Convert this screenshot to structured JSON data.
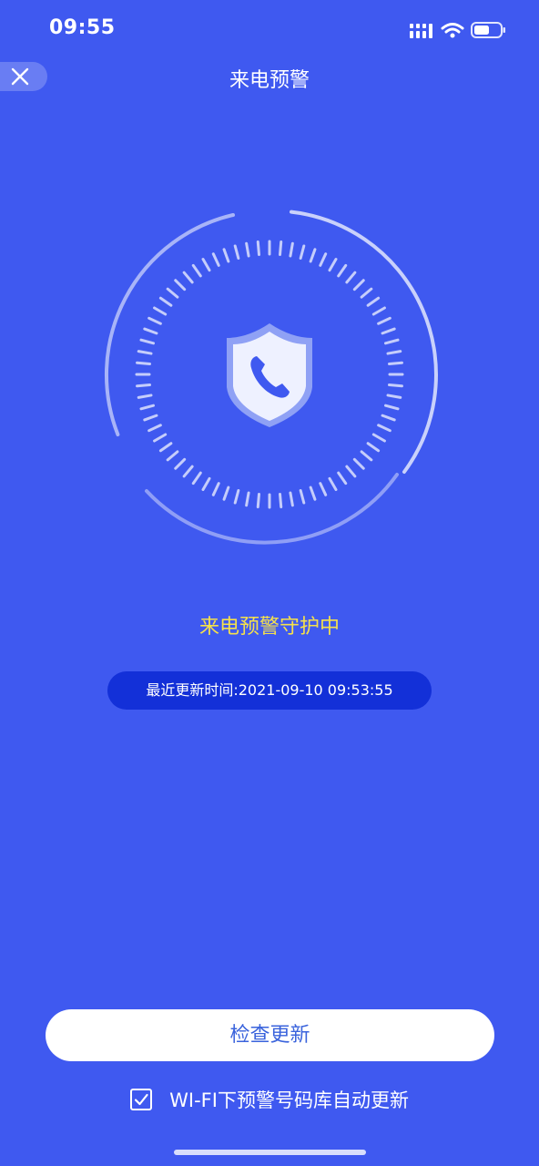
{
  "status_bar": {
    "time": "09:55",
    "icons": [
      "signal-icon",
      "wifi-icon",
      "battery-icon"
    ]
  },
  "nav": {
    "title": "来电预警",
    "close_icon": "close-icon"
  },
  "protection": {
    "shield_icon": "shield-phone-icon",
    "status_text": "来电预警守护中",
    "last_update": "最近更新时间:2021-09-10 09:53:55"
  },
  "actions": {
    "check_update_label": "检查更新",
    "auto_update_label": "WI-FI下预警号码库自动更新",
    "auto_update_checked": true
  },
  "colors": {
    "background": "#3F59F0",
    "status_text": "#F5E14B",
    "pill": "#1330D8",
    "button_text": "#3A63DC"
  }
}
